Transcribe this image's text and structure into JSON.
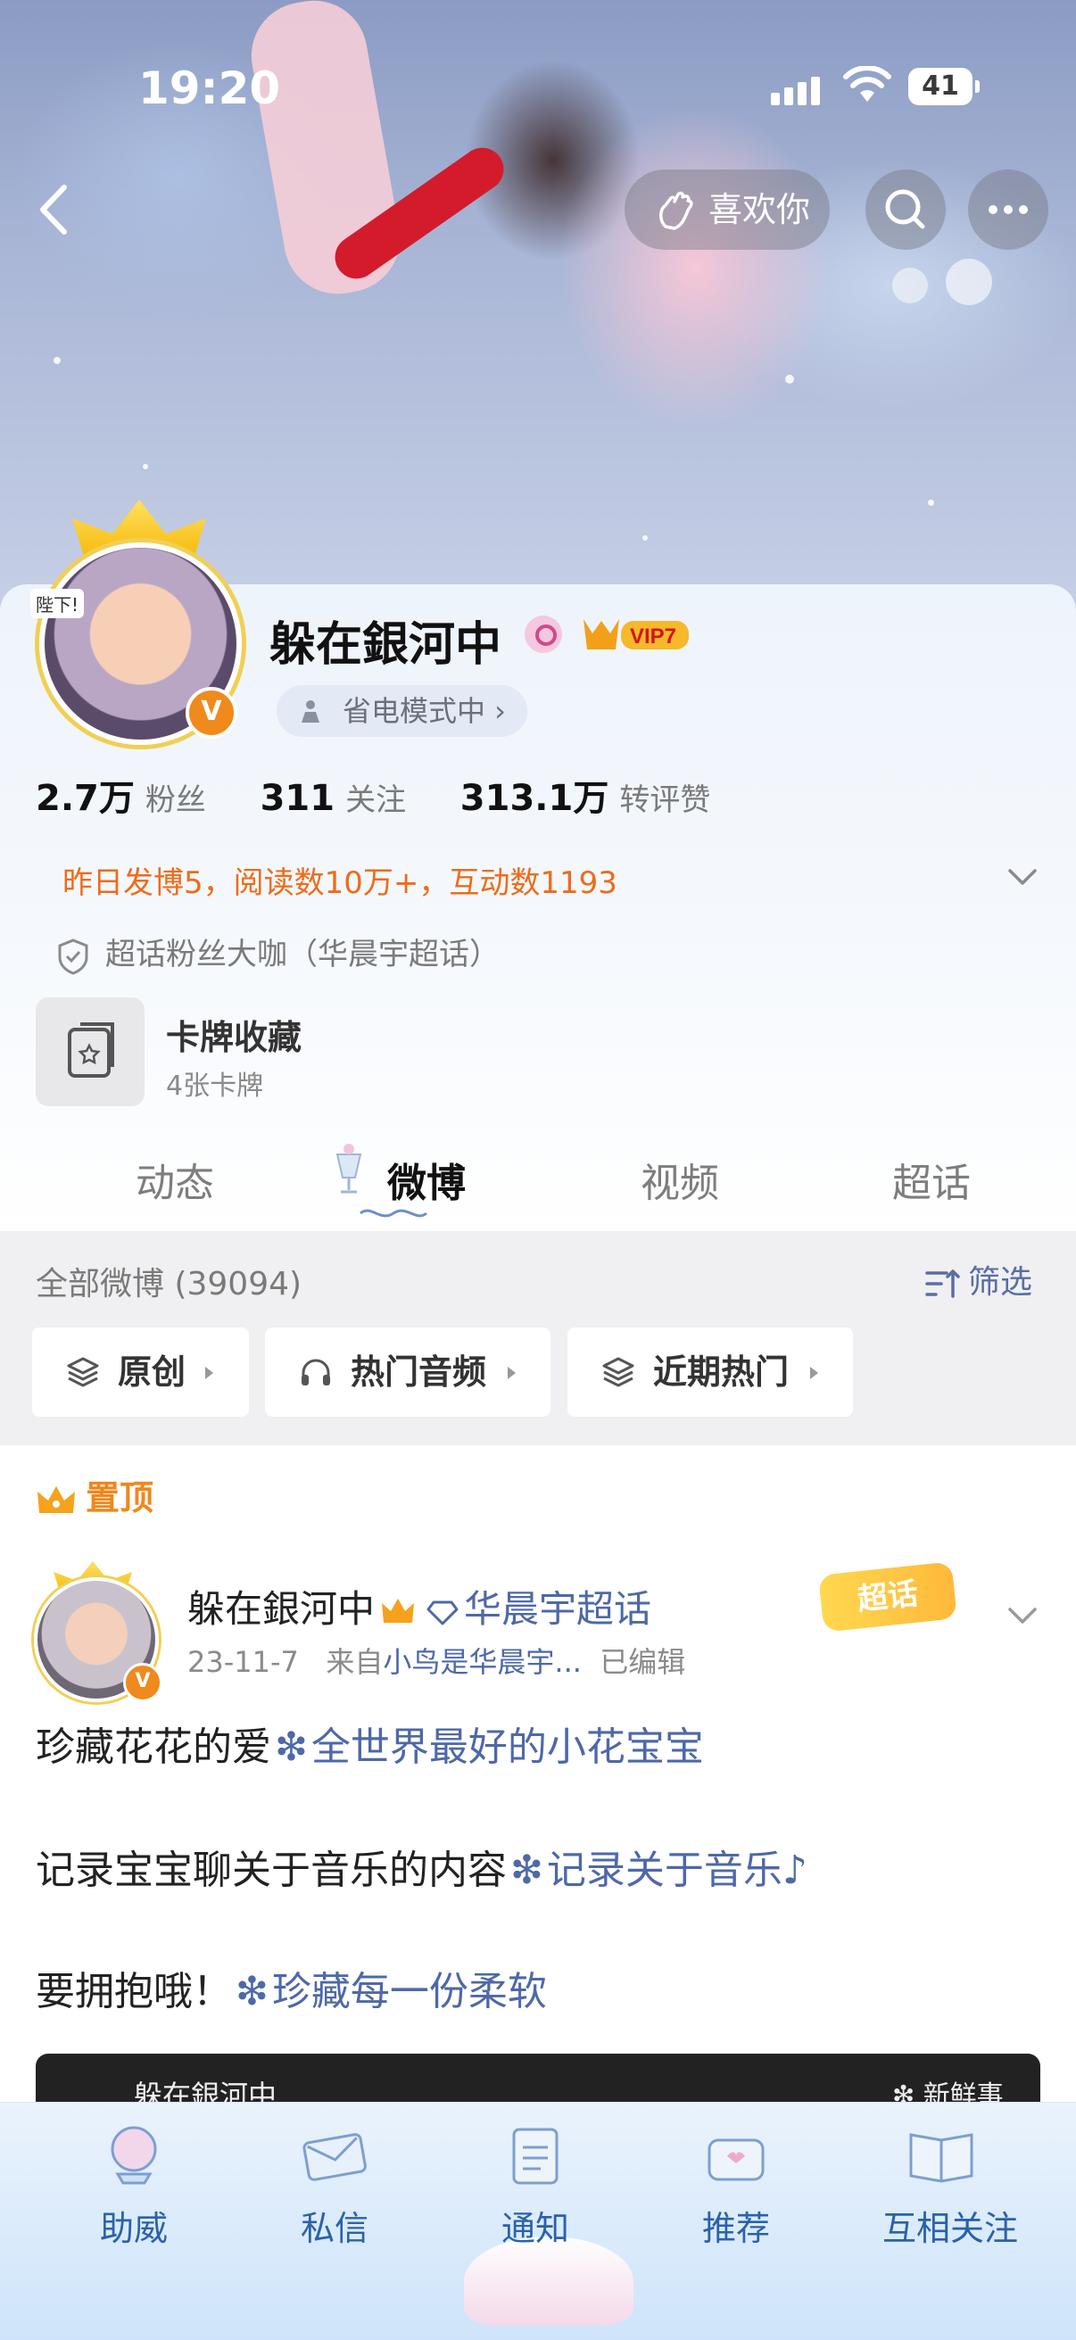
{
  "status_bar": {
    "time": "19:20",
    "battery": "41"
  },
  "header": {
    "like_label": "喜欢你"
  },
  "profile": {
    "avatar_tag": "陛下!",
    "verified_badge": "V",
    "name": "躲在銀河中",
    "vip_label": "VIP7",
    "power_mode": "省电模式中 ›",
    "stats": [
      {
        "value": "2.7万",
        "label": "粉丝"
      },
      {
        "value": "311",
        "label": "关注"
      },
      {
        "value": "313.1万",
        "label": "转评赞"
      }
    ],
    "yesterday_summary": "昨日发博5，阅读数10万+，互动数1193",
    "superfan": "超话粉丝大咖（华晨宇超话）",
    "card_collection": {
      "title": "卡牌收藏",
      "subtitle": "4张卡牌"
    }
  },
  "tabs": [
    {
      "label": "动态"
    },
    {
      "label": "微博"
    },
    {
      "label": "视频"
    },
    {
      "label": "超话"
    }
  ],
  "filter": {
    "all_count": "全部微博 (39094)",
    "filter_label": "筛选",
    "chips": [
      {
        "label": "原创"
      },
      {
        "label": "热门音频"
      },
      {
        "label": "近期热门"
      }
    ]
  },
  "post": {
    "pinned_label": "置顶",
    "author": "躲在銀河中",
    "topic": "华晨宇超话",
    "date": "23-11-7",
    "source_prefix": "来自",
    "source": "小鸟是华晨宇...",
    "edited": "已编辑",
    "badge": "超话",
    "verified_badge": "V",
    "lines": [
      {
        "text": "珍藏花花的爱",
        "link": "全世界最好的小花宝宝"
      },
      {
        "text": "记录宝宝聊关于音乐的内容",
        "link": "记录关于音乐♪"
      },
      {
        "text": "要拥抱哦！",
        "link": "珍藏每一份柔软"
      }
    ],
    "repost_name": "躲在銀河中",
    "repost_tag": "新鲜事"
  },
  "bottom_nav": [
    {
      "label": "助威"
    },
    {
      "label": "私信"
    },
    {
      "label": "通知"
    },
    {
      "label": "推荐"
    },
    {
      "label": "互相关注"
    }
  ],
  "colors": {
    "accent_orange": "#ef6b1a",
    "link_blue": "#4e68a8",
    "nav_blue": "#2a62a8",
    "verified_orange": "#f08a1c"
  }
}
